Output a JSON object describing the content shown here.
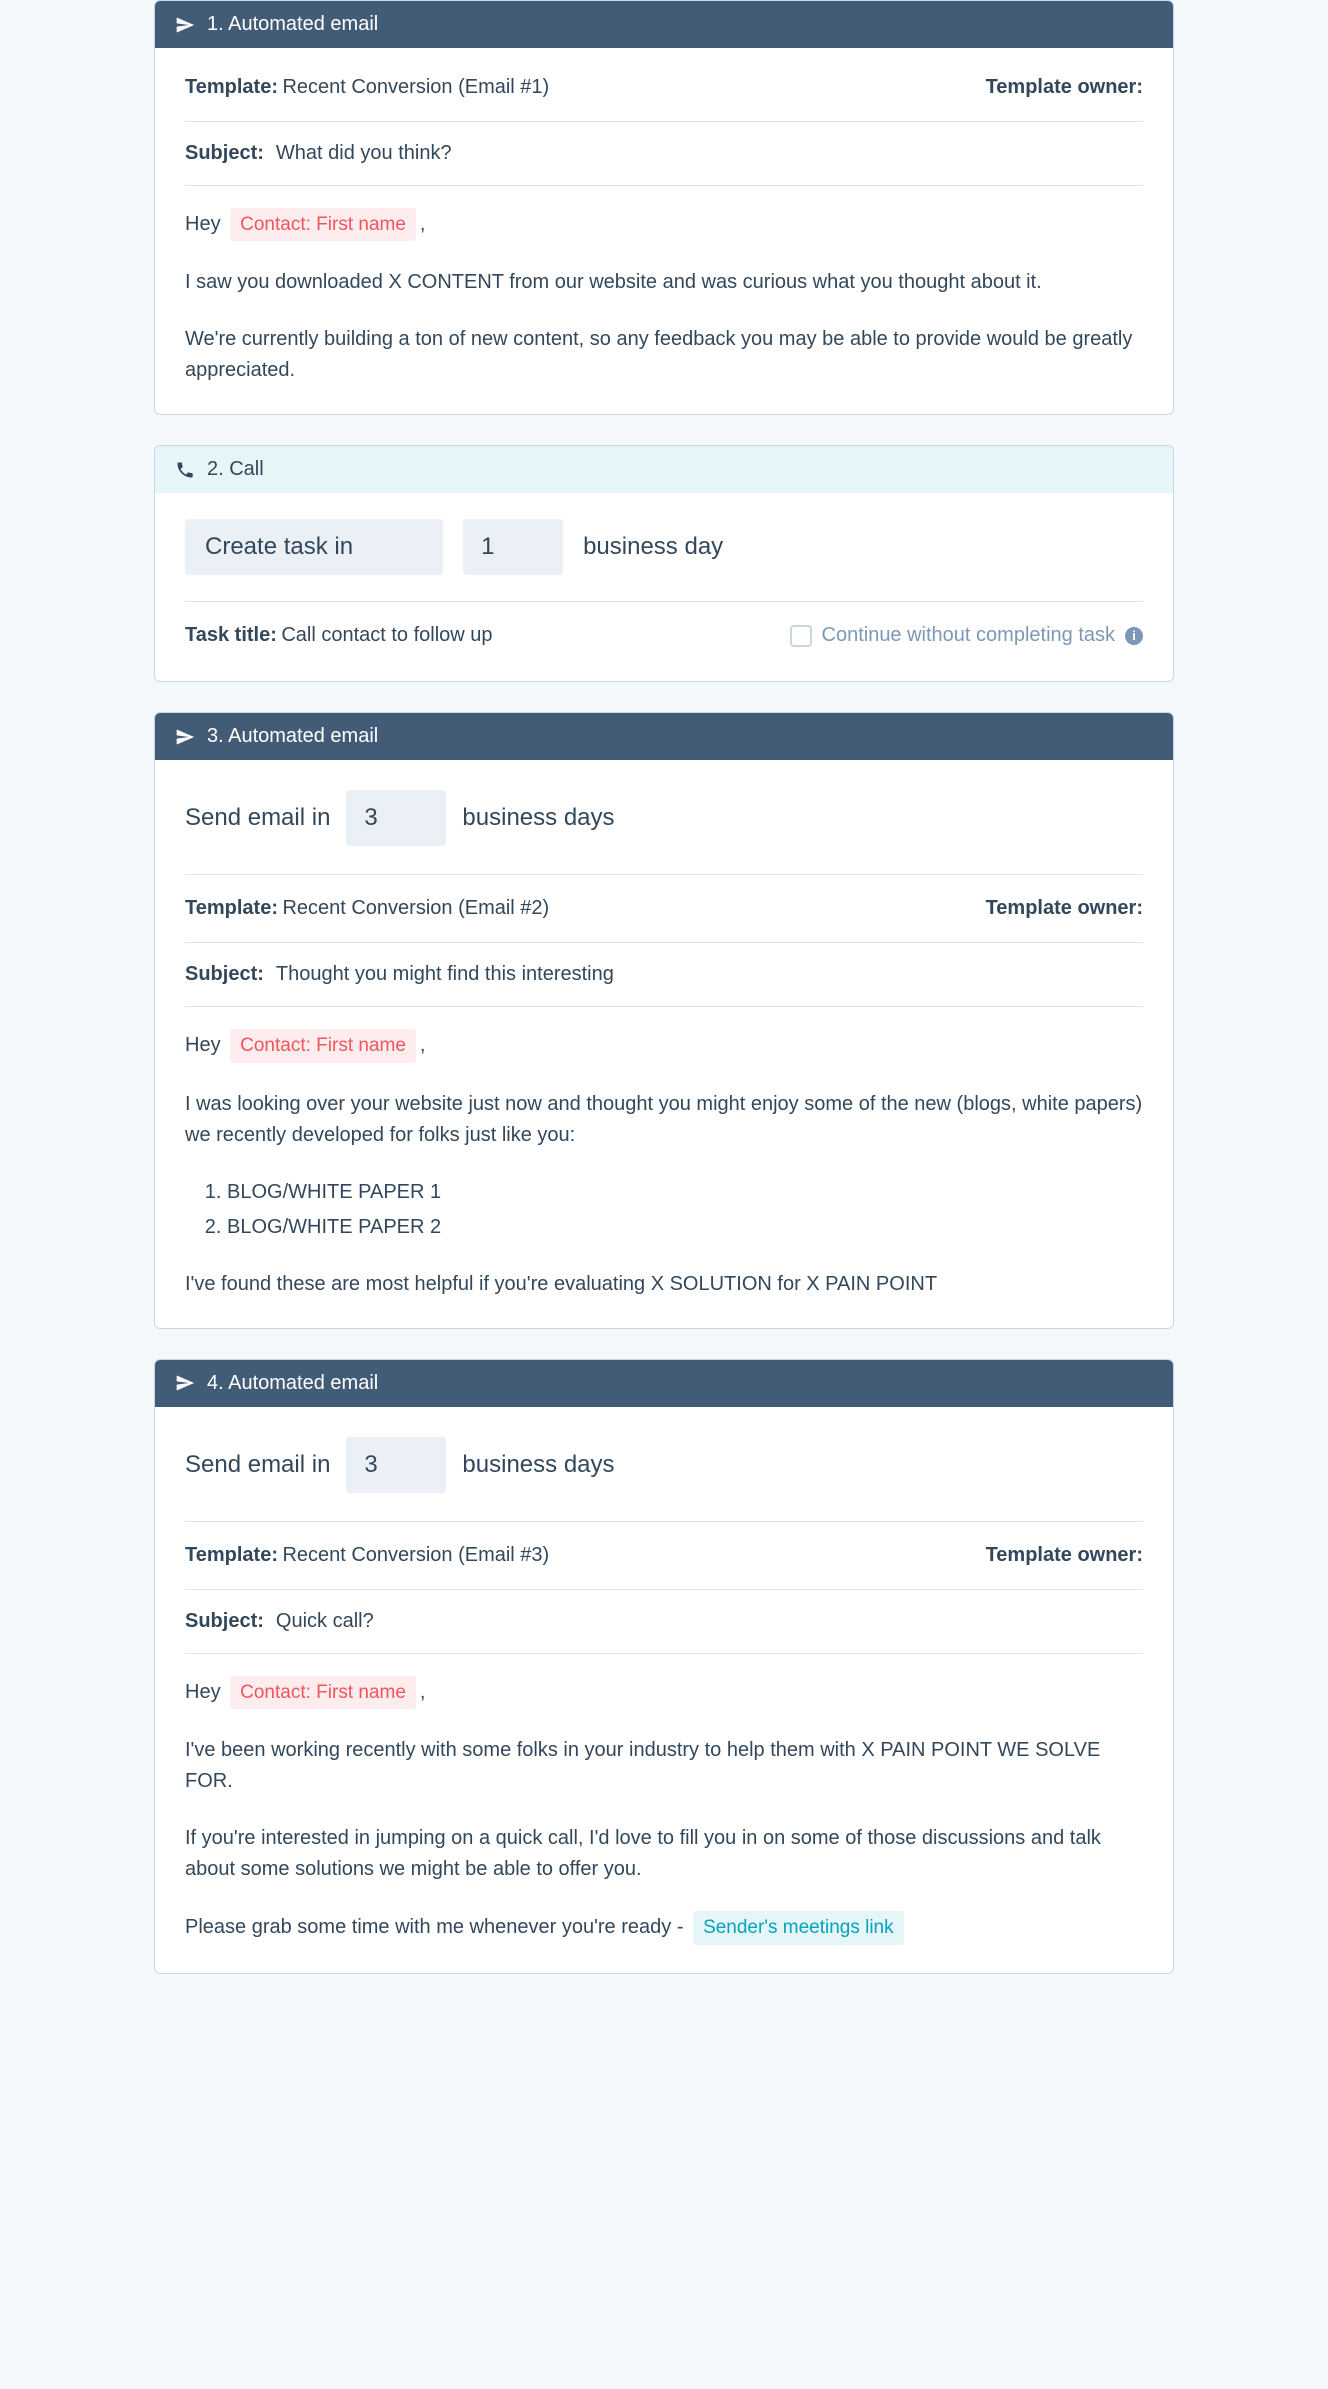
{
  "steps": {
    "s1": {
      "header": "1. Automated email",
      "template_label": "Template:",
      "template_value": "Recent Conversion (Email #1)",
      "owner_label": "Template owner:",
      "subject_label": "Subject:",
      "subject_value": "What did you think?",
      "greeting_pre": "Hey",
      "token": "Contact: First name",
      "greeting_post": ",",
      "p1": "I saw you downloaded X CONTENT from our website and was curious what you thought about it.",
      "p2": "We're currently building a ton of new content, so any feedback you may be able to provide would be greatly appreciated."
    },
    "s2": {
      "header": "2. Call",
      "create_label": "Create task in",
      "days": "1",
      "unit": "business day",
      "task_title_label": "Task title:",
      "task_title_value": "Call contact to follow up",
      "continue_label": "Continue without completing task"
    },
    "s3": {
      "header": "3. Automated email",
      "send_label": "Send email in",
      "days": "3",
      "unit": "business days",
      "template_label": "Template:",
      "template_value": "Recent Conversion (Email #2)",
      "owner_label": "Template owner:",
      "subject_label": "Subject:",
      "subject_value": "Thought you might find this interesting",
      "greeting_pre": "Hey",
      "token": "Contact: First name",
      "greeting_post": ",",
      "p1": "I was looking over your website just now and thought you might enjoy some of the new (blogs, white papers) we recently developed for folks just like you:",
      "li1": "BLOG/WHITE PAPER 1",
      "li2": "BLOG/WHITE PAPER 2",
      "p2": "I've found these are most helpful if you're evaluating X SOLUTION for X PAIN POINT"
    },
    "s4": {
      "header": "4. Automated email",
      "send_label": "Send email in",
      "days": "3",
      "unit": "business days",
      "template_label": "Template:",
      "template_value": "Recent Conversion (Email #3)",
      "owner_label": "Template owner:",
      "subject_label": "Subject:",
      "subject_value": "Quick call?",
      "greeting_pre": "Hey",
      "token": "Contact: First name",
      "greeting_post": ",",
      "p1": "I've been working recently with some folks in your industry to help them with X PAIN POINT WE SOLVE FOR.",
      "p2": "If you're interested in jumping on a quick call, I'd love to fill you in on some of those discussions and talk about some solutions we might be able to offer you.",
      "p3_pre": "Please grab some time with me whenever you're ready -",
      "meeting_token": "Sender's meetings link"
    }
  }
}
